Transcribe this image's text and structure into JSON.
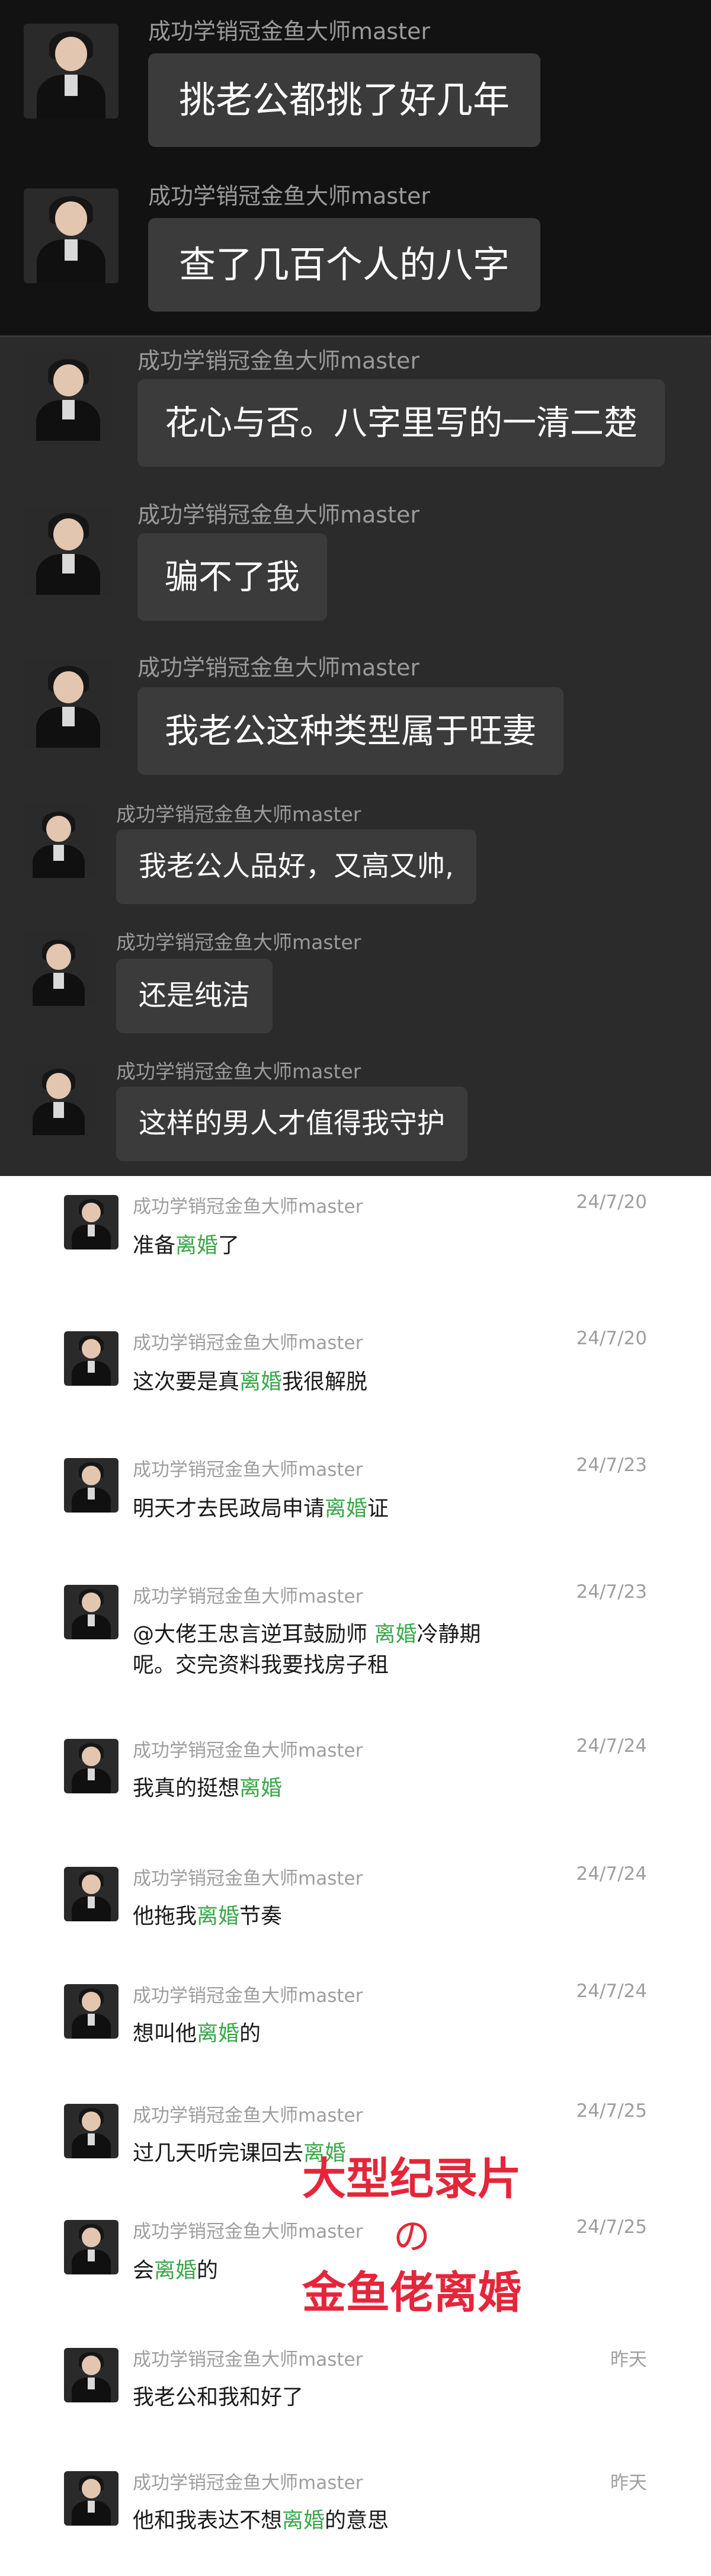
{
  "sender_name": "成功学销冠金鱼大师master",
  "dark_messages": [
    {
      "text": "挑老公都挑了好几年"
    },
    {
      "text": "查了几百个人的八字"
    },
    {
      "text": "花心与否。八字里写的一清二楚"
    },
    {
      "text": "骗不了我"
    },
    {
      "text": "我老公这种类型属于旺妻"
    },
    {
      "text": "我老公人品好，又高又帅,"
    },
    {
      "text": "还是纯洁"
    },
    {
      "text": "这样的男人才值得我守护"
    }
  ],
  "light_messages": [
    {
      "date": "24/7/20",
      "parts": [
        "准备",
        "离婚",
        "了"
      ]
    },
    {
      "date": "24/7/20",
      "parts": [
        "这次要是真",
        "离婚",
        "我很解脱"
      ]
    },
    {
      "date": "24/7/23",
      "parts": [
        "明天才去民政局申请",
        "离婚",
        "证"
      ]
    },
    {
      "date": "24/7/23",
      "parts": [
        "@大佬王忠言逆耳鼓励师 ",
        "离婚",
        "冷静期"
      ],
      "line2": "呢。交完资料我要找房子租"
    },
    {
      "date": "24/7/24",
      "parts": [
        "我真的挺想",
        "离婚",
        ""
      ]
    },
    {
      "date": "24/7/24",
      "parts": [
        "他拖我",
        "离婚",
        "节奏"
      ]
    },
    {
      "date": "24/7/24",
      "parts": [
        "想叫他",
        "离婚",
        "的"
      ]
    },
    {
      "date": "24/7/25",
      "parts": [
        "过几天听完课回去",
        "离婚",
        ""
      ]
    },
    {
      "date": "24/7/25",
      "parts": [
        "会",
        "离婚",
        "的"
      ]
    },
    {
      "date": "昨天",
      "parts": [
        "我老公和我和好了",
        "",
        ""
      ]
    },
    {
      "date": "昨天",
      "parts": [
        "他和我表达不想",
        "离婚",
        "的意思"
      ]
    }
  ],
  "overlay": {
    "line1": "大型纪录片",
    "line2": "の",
    "line3": "金鱼佬离婚"
  },
  "colors": {
    "highlight": "#3aa84a",
    "overlay": "#e5263a"
  }
}
